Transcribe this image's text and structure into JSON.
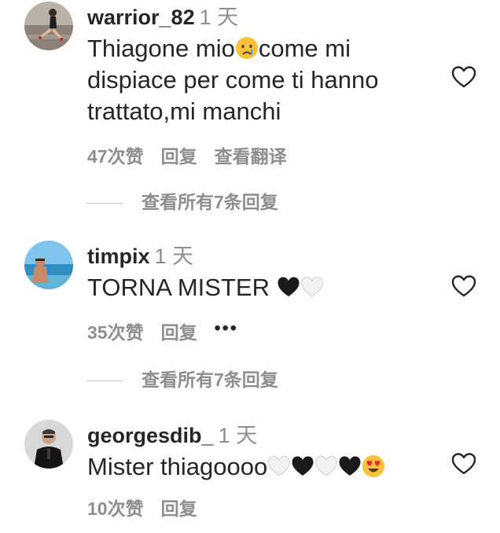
{
  "comments": [
    {
      "username": "warrior_82",
      "time": "1 天",
      "text_parts": [
        "Thiagone mio",
        "come mi dispiace per come ti hanno trattato,mi manchi"
      ],
      "emojis": [
        "crying-face-emoji"
      ],
      "likes": "47次赞",
      "reply": "回复",
      "translate": "查看翻译",
      "view_replies": "查看所有7条回复"
    },
    {
      "username": "timpix",
      "time": "1 天",
      "text": "TORNA MISTER ",
      "emojis": [
        "black-heart-emoji",
        "white-heart-emoji"
      ],
      "likes": "35次赞",
      "reply": "回复",
      "more": "•••",
      "view_replies": "查看所有7条回复"
    },
    {
      "username": "georgesdib_",
      "time": "1 天",
      "text": "Mister thiagoooo",
      "emojis": [
        "white-heart-emoji",
        "black-heart-emoji",
        "white-heart-emoji",
        "black-heart-emoji",
        "heart-eyes-emoji"
      ],
      "likes": "10次赞",
      "reply": "回复"
    }
  ],
  "icons": {
    "like": "heart-outline-icon"
  },
  "colors": {
    "text": "#262626",
    "secondary": "#8e8e8e"
  }
}
